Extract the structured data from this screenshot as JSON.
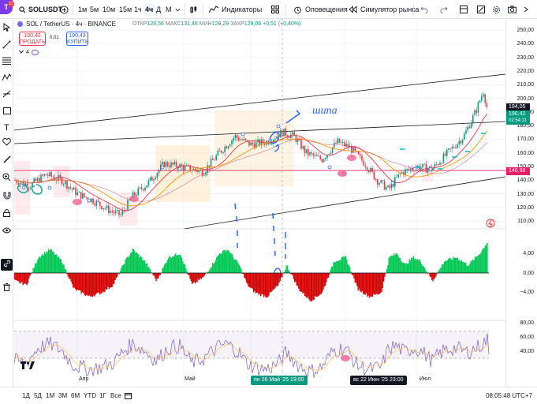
{
  "app": {
    "logo_text": "T",
    "badge": "11"
  },
  "toolbar": {
    "symbol": "SOLUSDT",
    "intervals": [
      "1м",
      "5м",
      "10м",
      "15м",
      "1ч",
      "4ч",
      "Д",
      "М"
    ],
    "active_interval": "4ч",
    "indicators_label": "Индикаторы",
    "alerts_label": "Оповещения",
    "replay_label": "Симулятор рынка"
  },
  "legend": {
    "title": "SOL / TetherUS · 4ч · BINANCE",
    "open_label": "ОТКР",
    "open": "128,56",
    "high_label": "МАКС",
    "high": "131,48",
    "low_label": "МИН",
    "low": "128,29",
    "close_label": "ЗАКР",
    "close": "129,06",
    "change": "+0,51 (+0,40%)",
    "sell_price": "190,42",
    "sell_label": "ПРОДАТЬ",
    "spread": "0,01",
    "buy_price": "190,43",
    "buy_label": "КУПИТЬ",
    "indicator_count": "4"
  },
  "price_axis": {
    "ticks": [
      "250,00",
      "240,00",
      "230,00",
      "220,00",
      "210,00",
      "200,00",
      "190,00",
      "180,00",
      "170,00",
      "160,00",
      "150,00",
      "140,00",
      "130,00",
      "120,00",
      "110,00"
    ],
    "current_price": "194,05",
    "bid_price": "190,42",
    "countdown": "02:54:11",
    "line_price": "146,98"
  },
  "oscillator_axis": {
    "ticks": [
      "4,00",
      "0,00",
      "−4,00"
    ]
  },
  "rsi_axis": {
    "ticks": [
      "80,00",
      "60,00",
      "40,00"
    ]
  },
  "annotation_text": "шипа",
  "time_axis": {
    "labels": [
      "Апр",
      "Май",
      "Июл"
    ],
    "crosshair_date": "пн 26 Май '25   19:00",
    "hover_date": "вс 22 Июн '25   23:00"
  },
  "bottom": {
    "ranges": [
      "1Д",
      "5Д",
      "1М",
      "3М",
      "6М",
      "YTD",
      "1Г",
      "Все"
    ],
    "clock": "08:05:48 UTC+7"
  },
  "colors": {
    "up": "#089981",
    "down": "#f23645",
    "accent": "#2962ff",
    "rsi": "#7e57c2",
    "hline": "#e91e63"
  }
}
